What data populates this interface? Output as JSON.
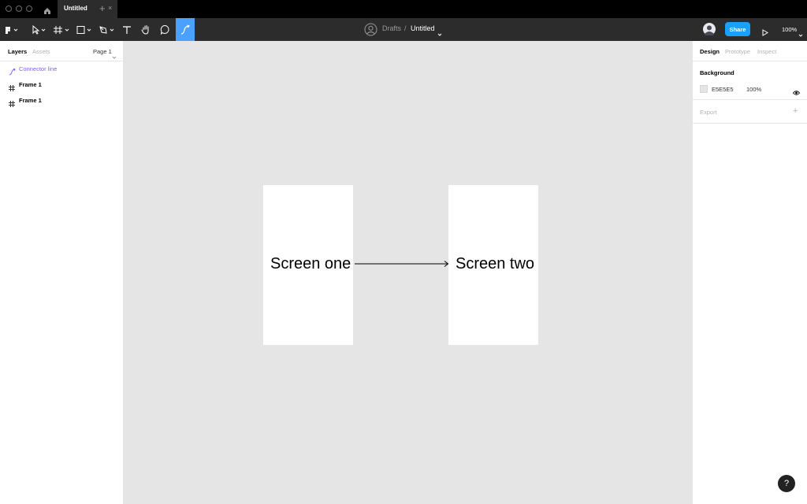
{
  "titlebar": {
    "tab_label": "Untitled",
    "close_glyph": "×",
    "new_tab_glyph": "+"
  },
  "toolbar": {
    "tools": [
      "main-menu-icon",
      "move-tool-icon",
      "frame-tool-icon",
      "shape-tool-icon",
      "pen-tool-icon",
      "text-tool-icon",
      "hand-tool-icon",
      "comment-tool-icon",
      "connector-tool-icon"
    ],
    "active_tool": "connector-tool-icon",
    "breadcrumb": {
      "project": "Drafts",
      "separator": "/",
      "file": "Untitled"
    },
    "share_label": "Share",
    "zoom": "100%",
    "accent_color": "#18a0fb",
    "active_tool_color": "#4aa1ff"
  },
  "left_panel": {
    "tabs": [
      "Layers",
      "Assets"
    ],
    "active_tab": "Layers",
    "page_selector": "Page 1",
    "layers": [
      {
        "name": "Connector line",
        "type": "connector",
        "selected": true
      },
      {
        "name": "Frame 1",
        "type": "frame"
      },
      {
        "name": "Frame 1",
        "type": "frame"
      }
    ],
    "selected_color": "#7b61ff"
  },
  "canvas": {
    "background": "#e5e5e5",
    "frames": [
      {
        "text": "Screen one"
      },
      {
        "text": "Screen two"
      }
    ]
  },
  "right_panel": {
    "tabs": [
      "Design",
      "Prototype",
      "Inspect"
    ],
    "active_tab": "Design",
    "background": {
      "heading": "Background",
      "hex": "E5E5E5",
      "opacity": "100%"
    },
    "export": {
      "heading": "Export",
      "add_glyph": "+"
    }
  },
  "help_glyph": "?"
}
